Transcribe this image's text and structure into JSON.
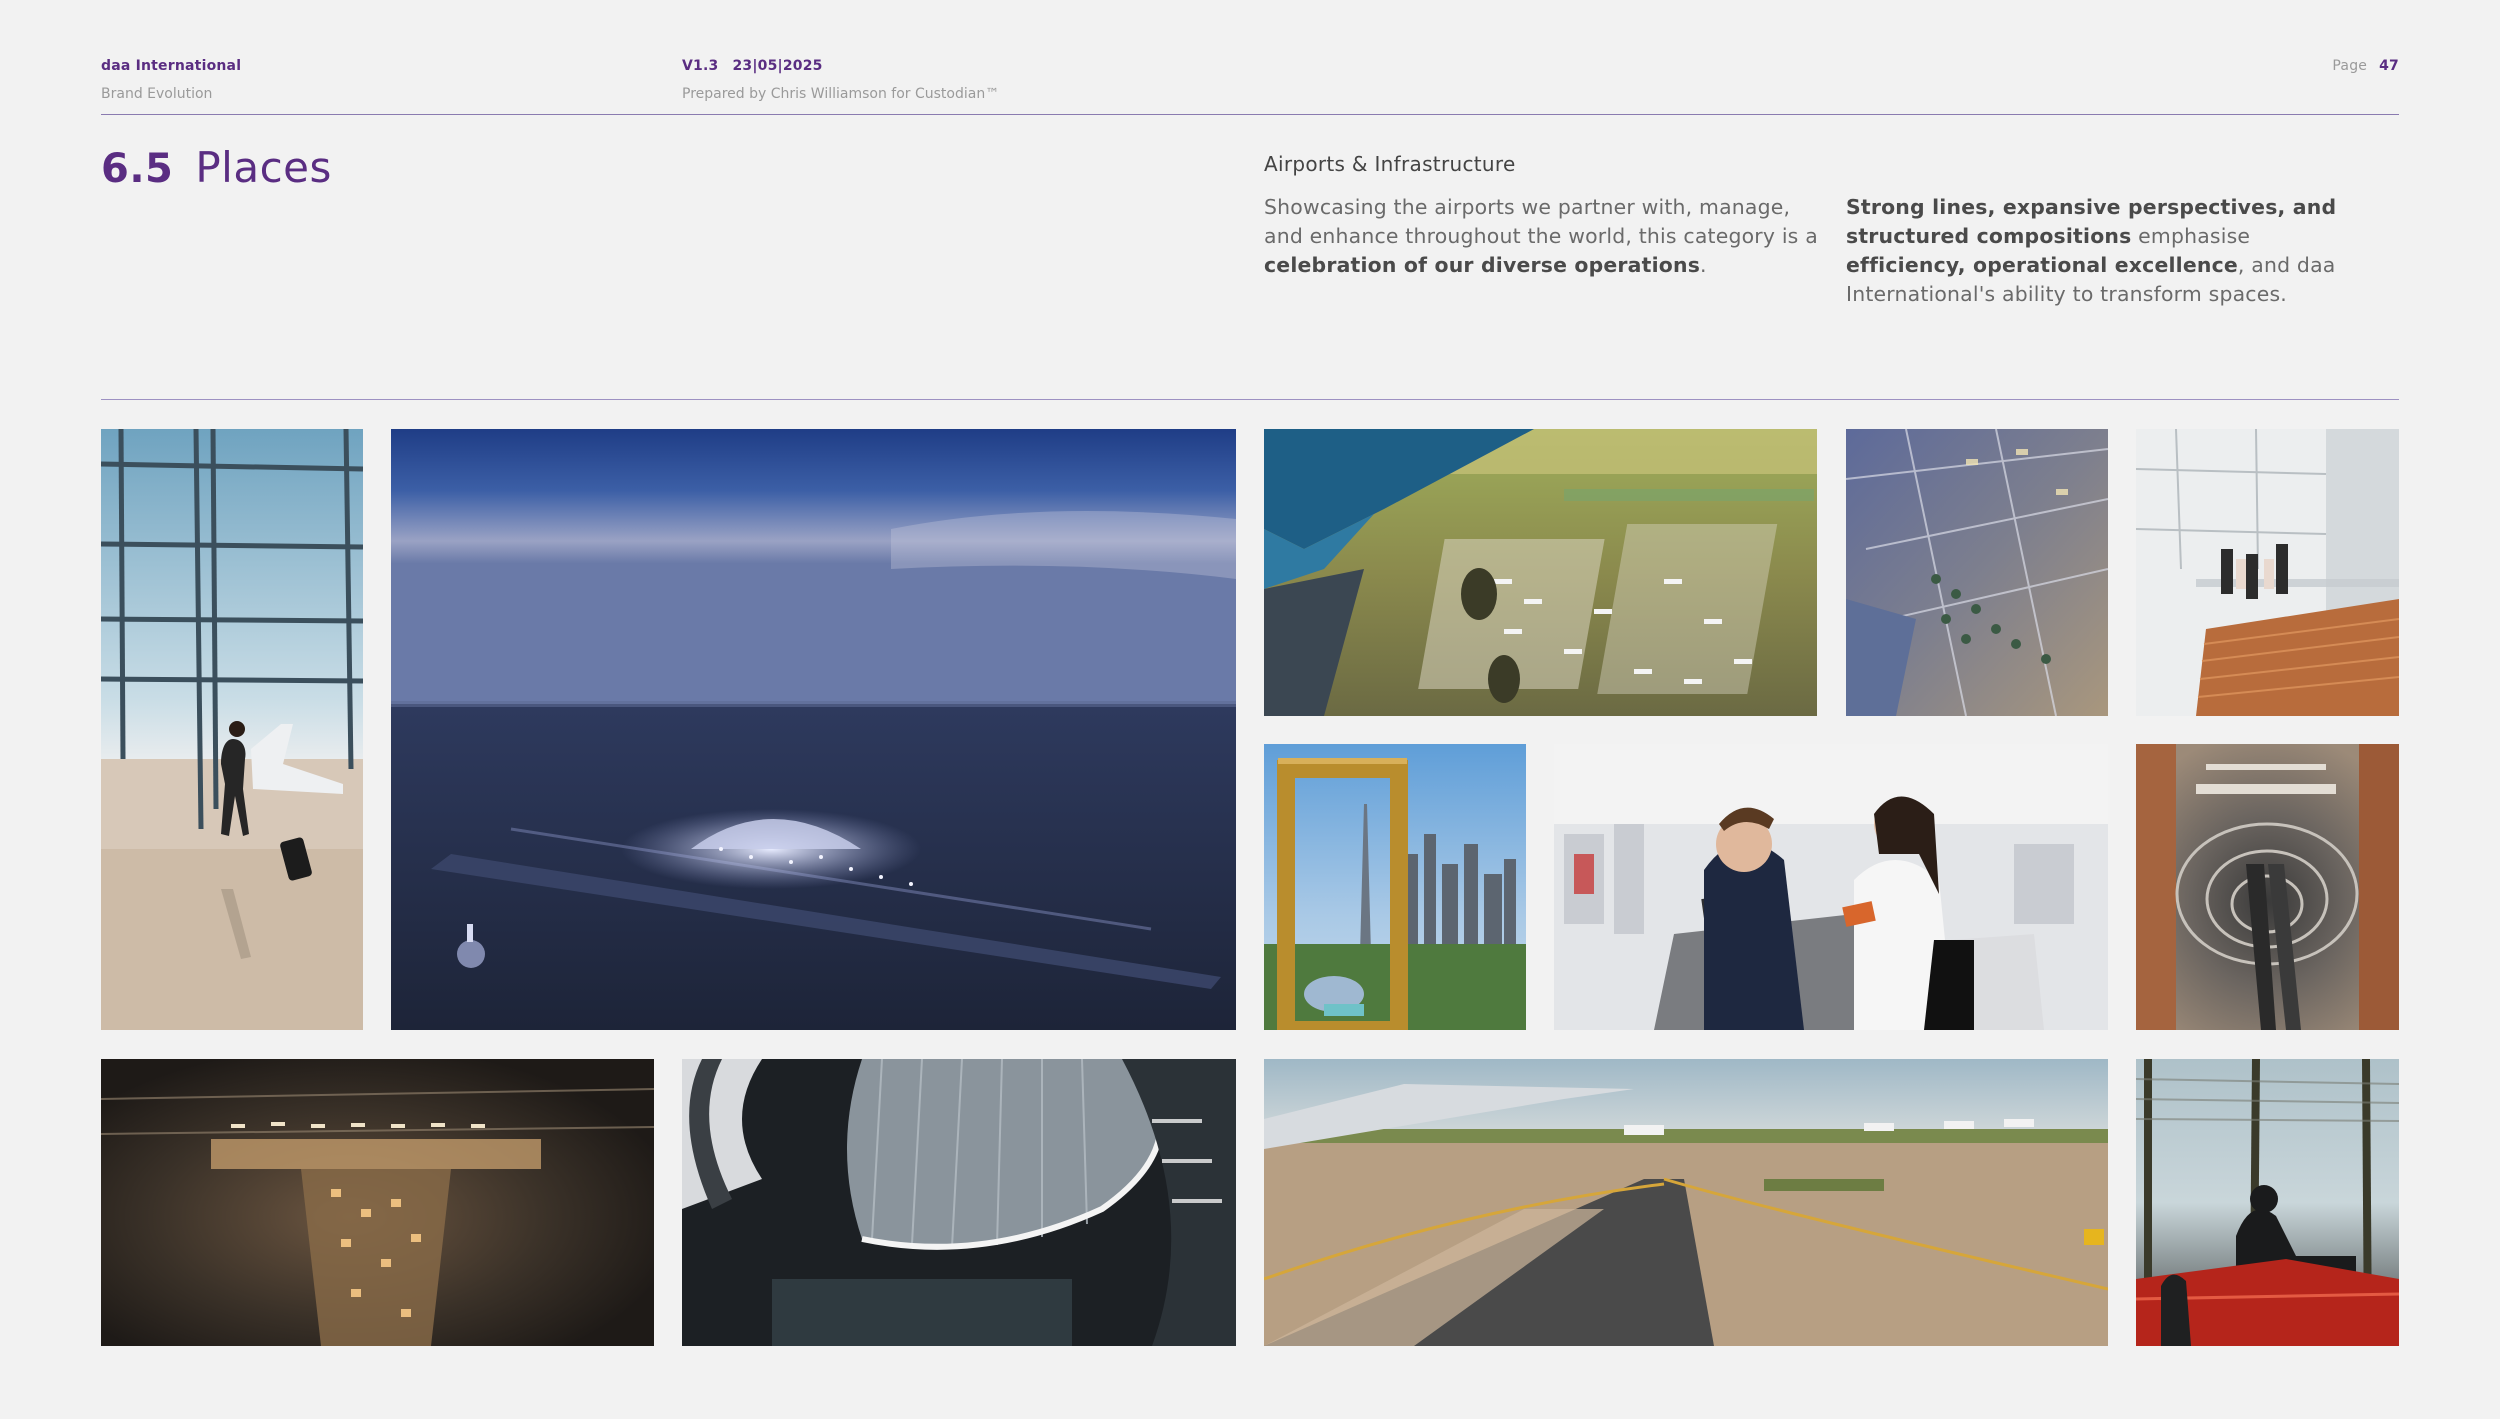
{
  "header": {
    "company": "daa International",
    "document": "Brand Evolution",
    "version": "V1.3",
    "date": "23|05|2025",
    "prepared_by": "Prepared by Chris Williamson for Custodian™",
    "page_label": "Page",
    "page_number": "47"
  },
  "section": {
    "number": "6.5",
    "title": "Places"
  },
  "intro": {
    "subheading": "Airports & Infrastructure",
    "col1_a": "Showcasing the airports we partner with, manage, and enhance throughout the world, this category is a ",
    "col1_bold": "celebration of our diverse operations",
    "col1_b": ".",
    "col2_bold1": "Strong lines, expansive perspectives, and structured compositions",
    "col2_a": " emphasise ",
    "col2_bold2": "efficiency, operational excellence",
    "col2_b": ", and daa International's ability to transform spaces."
  },
  "images": [
    {
      "name": "traveller-at-window-photo"
    },
    {
      "name": "airport-night-aerial-render"
    },
    {
      "name": "airport-aerial-from-wing-photo"
    },
    {
      "name": "masterplan-aerial-render"
    },
    {
      "name": "terminal-staircase-photo"
    },
    {
      "name": "dubai-frame-photo"
    },
    {
      "name": "check-in-desk-photo"
    },
    {
      "name": "terminal-atrium-escalators-photo"
    },
    {
      "name": "airport-night-overhead-render"
    },
    {
      "name": "curved-terminal-roof-photo"
    },
    {
      "name": "taxiway-apron-photo"
    },
    {
      "name": "lounge-silhouette-photo"
    }
  ]
}
